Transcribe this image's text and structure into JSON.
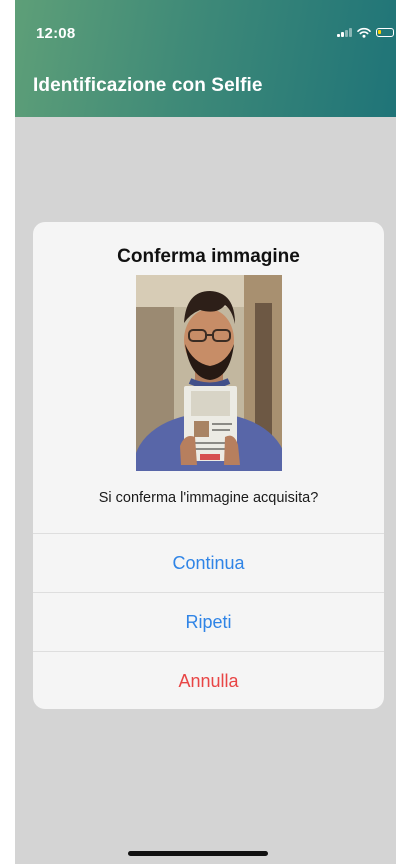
{
  "status_bar": {
    "time": "12:08"
  },
  "header": {
    "title": "Identificazione con Selfie"
  },
  "dialog": {
    "title": "Conferma immagine",
    "message": "Si conferma l'immagine acquisita?",
    "buttons": {
      "continue_label": "Continua",
      "repeat_label": "Ripeti",
      "cancel_label": "Annulla"
    }
  },
  "icons": {
    "signal": "signal-icon",
    "wifi": "wifi-icon",
    "battery": "battery-icon"
  },
  "colors": {
    "header_start": "#5e9f78",
    "header_end": "#1f7478",
    "action_blue": "#2f84e6",
    "action_red": "#e84545",
    "overlay_gray": "#d4d4d4"
  }
}
